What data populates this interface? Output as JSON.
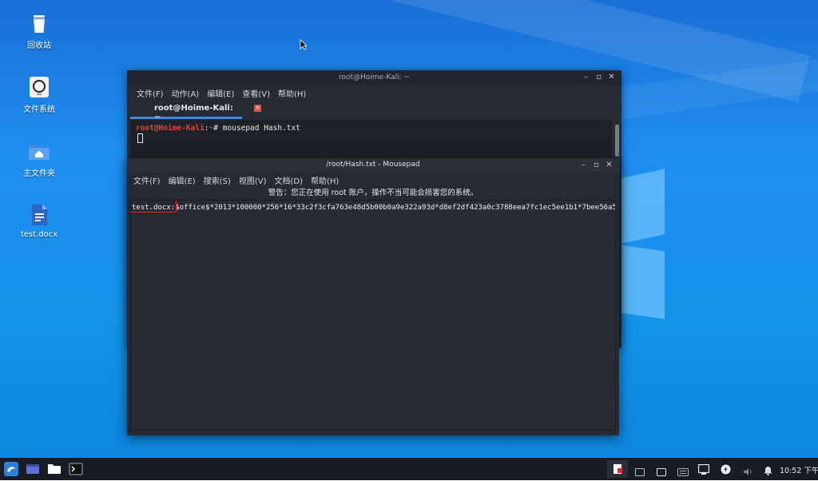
{
  "desktop": {
    "icons": [
      {
        "label": "回收站",
        "icon": "trash-icon"
      },
      {
        "label": "文件系统",
        "icon": "drive-icon"
      },
      {
        "label": "主文件夹",
        "icon": "home-folder-icon"
      },
      {
        "label": "test.docx",
        "icon": "document-icon"
      }
    ]
  },
  "terminal": {
    "title": "root@Hoime-Kali: ~",
    "menu": [
      "文件(F)",
      "动作(A)",
      "编辑(E)",
      "查看(V)",
      "帮助(H)"
    ],
    "tab_label": "root@Hoime-Kali: ~",
    "prompt_user": "root@Hoime-Kali",
    "prompt_sep": ":",
    "prompt_path": "~",
    "prompt_symbol": "# ",
    "command": "mousepad Hash.txt"
  },
  "mousepad": {
    "title": "/root/Hash.txt - Mousepad",
    "menu": [
      "文件(F)",
      "编辑(E)",
      "搜索(S)",
      "视图(V)",
      "文档(D)",
      "帮助(H)"
    ],
    "warning": "警告：您正在使用 root 账户，操作不当可能会损害您的系统。",
    "line_prefix": "test.docx:",
    "line_hash": "$office$*2013*100000*256*16*33c2f3cfa763e48d5b00b0a9e322a93d*d8ef2df423a0c3788eea7fc1ec5ee1b1*7bee56a5"
  },
  "taskbar": {
    "clock": "10:52 下午"
  },
  "colors": {
    "accent": "#3b8ae0",
    "prompt_user": "#e0453a",
    "highlight_box": "#e1261d"
  }
}
